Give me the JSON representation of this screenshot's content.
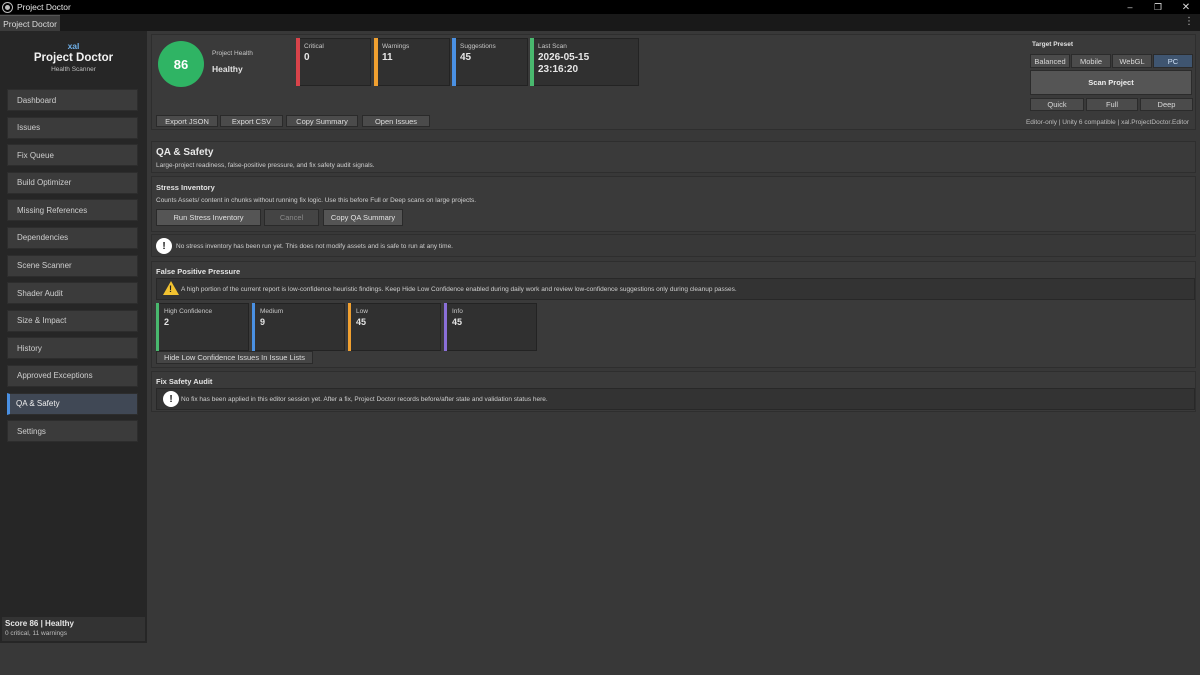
{
  "window": {
    "title": "Project Doctor",
    "tab": "Project Doctor"
  },
  "brand": {
    "org": "xal",
    "name": "Project Doctor",
    "subtitle": "Health Scanner"
  },
  "nav": [
    {
      "label": "Dashboard"
    },
    {
      "label": "Issues"
    },
    {
      "label": "Fix Queue"
    },
    {
      "label": "Build Optimizer"
    },
    {
      "label": "Missing References"
    },
    {
      "label": "Dependencies"
    },
    {
      "label": "Scene Scanner"
    },
    {
      "label": "Shader Audit"
    },
    {
      "label": "Size & Impact"
    },
    {
      "label": "History"
    },
    {
      "label": "Approved Exceptions"
    },
    {
      "label": "QA & Safety",
      "active": true
    },
    {
      "label": "Settings"
    }
  ],
  "footer": {
    "score": "Score 86 | Healthy",
    "counts": "0 critical, 11 warnings"
  },
  "health": {
    "score": "86",
    "label": "Project Health",
    "status": "Healthy",
    "color": "#2fb464"
  },
  "metrics": {
    "critical": {
      "label": "Critical",
      "value": "0",
      "color": "#d8434a"
    },
    "warnings": {
      "label": "Warnings",
      "value": "11",
      "color": "#f0a030"
    },
    "suggestions": {
      "label": "Suggestions",
      "value": "45",
      "color": "#4a90e2"
    },
    "last_scan": {
      "label": "Last Scan",
      "date": "2026-05-15",
      "time": "23:16:20",
      "color": "#49b86e"
    }
  },
  "exports": {
    "json": "Export JSON",
    "csv": "Export CSV",
    "summary": "Copy Summary",
    "issues": "Open Issues"
  },
  "preset": {
    "title": "Target Preset",
    "options": [
      "Balanced",
      "Mobile",
      "WebGL",
      "PC"
    ],
    "selected": "PC",
    "scan": "Scan Project",
    "depths": [
      "Quick",
      "Full",
      "Deep"
    ],
    "compat": "Editor-only | Unity 6 compatible | xal.ProjectDoctor.Editor"
  },
  "qa": {
    "title": "QA & Safety",
    "subtitle": "Large-project readiness, false-positive pressure, and fix safety audit signals."
  },
  "stress": {
    "title": "Stress Inventory",
    "desc": "Counts Assets/ content in chunks without running fix logic. Use this before Full or Deep scans on large projects.",
    "run": "Run Stress Inventory",
    "cancel": "Cancel",
    "copy": "Copy QA Summary",
    "note": "No stress inventory has been run yet. This does not modify assets and is safe to run at any time."
  },
  "fpp": {
    "title": "False Positive Pressure",
    "warning": "A high portion of the current report is low-confidence heuristic findings. Keep Hide Low Confidence enabled during daily work and review low-confidence suggestions only during cleanup passes.",
    "levels": [
      {
        "label": "High Confidence",
        "value": "2",
        "color": "#49b86e"
      },
      {
        "label": "Medium",
        "value": "9",
        "color": "#4a90e2"
      },
      {
        "label": "Low",
        "value": "45",
        "color": "#f0a030"
      },
      {
        "label": "Info",
        "value": "45",
        "color": "#8a6fd8"
      }
    ],
    "hide_toggle": "Hide Low Confidence Issues In Issue Lists"
  },
  "fix_audit": {
    "title": "Fix Safety Audit",
    "note": "No fix has been applied in this editor session yet. After a fix, Project Doctor records before/after state and validation status here."
  }
}
